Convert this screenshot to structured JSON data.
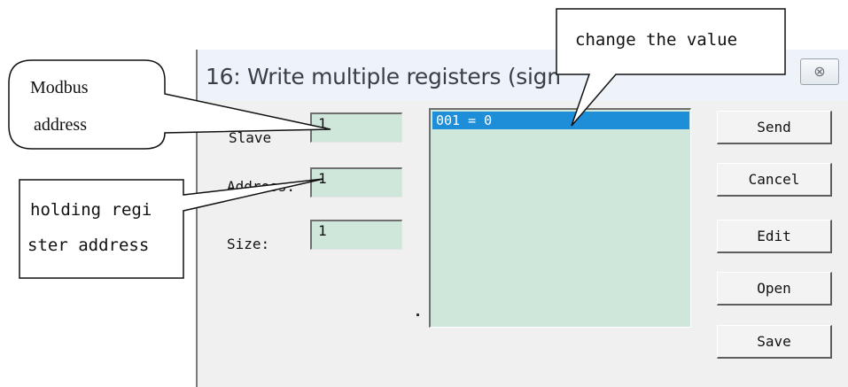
{
  "dialog": {
    "title": "16: Write multiple registers (sign",
    "close_glyph": "⊗",
    "fields": {
      "slave_label": "Slave",
      "slave_value": "1",
      "address_label": "Address:",
      "address_value": "1",
      "size_label": "Size:",
      "size_value": "1"
    },
    "list": {
      "items": [
        "001 = 0"
      ]
    },
    "buttons": {
      "send": "Send",
      "cancel": "Cancel",
      "edit": "Edit",
      "open": "Open",
      "save": "Save"
    }
  },
  "callouts": {
    "modbus_line1": "Modbus",
    "modbus_line2": "address",
    "holding_line1": "holding regi",
    "holding_line2": "ster address",
    "change_value": "change the value"
  },
  "colors": {
    "field_bg": "#cfe6da",
    "selection": "#1f8ed8",
    "titlebar_bg": "#eef3fa"
  }
}
